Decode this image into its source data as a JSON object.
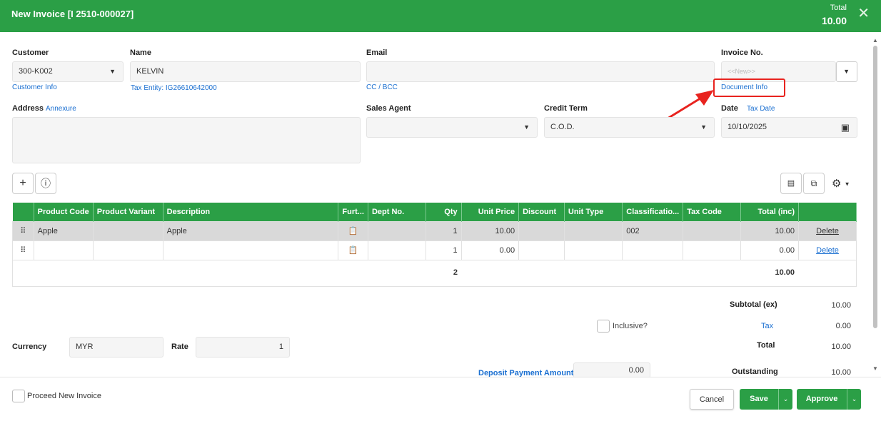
{
  "header": {
    "title": "New Invoice [I 2510-000027]",
    "total_label": "Total",
    "total_value": "10.00",
    "close": "✕"
  },
  "customer": {
    "label": "Customer",
    "value": "300-K002",
    "info_link": "Customer Info"
  },
  "name": {
    "label": "Name",
    "value": "KELVIN",
    "tax_entity": "Tax Entity: IG26610642000"
  },
  "email": {
    "label": "Email",
    "value": "",
    "cc_link": "CC / BCC"
  },
  "invoice_no": {
    "label": "Invoice No.",
    "placeholder": "<<New>>",
    "doc_info_link": "Document Info"
  },
  "address": {
    "label": "Address",
    "annexure_link": "Annexure"
  },
  "sales_agent": {
    "label": "Sales Agent",
    "value": ""
  },
  "credit_term": {
    "label": "Credit Term",
    "value": "C.O.D."
  },
  "date": {
    "label": "Date",
    "tax_date_link": "Tax Date",
    "value": "10/10/2025"
  },
  "toolbar": {
    "add": "+",
    "info": "ⓘ",
    "settings": "⚙"
  },
  "grid": {
    "columns": [
      "",
      "Product Code",
      "Product Variant",
      "Description",
      "Furt...",
      "Dept No.",
      "Qty",
      "Unit Price",
      "Discount",
      "Unit Type",
      "Classificatio...",
      "Tax Code",
      "Total (inc)",
      ""
    ],
    "rows": [
      {
        "product_code": "Apple",
        "variant": "",
        "description": "Apple",
        "dept": "",
        "qty": "1",
        "unit_price": "10.00",
        "discount": "",
        "unit_type": "",
        "classification": "002",
        "tax_code": "",
        "total": "10.00",
        "action": "Delete"
      },
      {
        "product_code": "",
        "variant": "",
        "description": "",
        "dept": "",
        "qty": "1",
        "unit_price": "0.00",
        "discount": "",
        "unit_type": "",
        "classification": "",
        "tax_code": "",
        "total": "0.00",
        "action": "Delete"
      }
    ],
    "total_qty": "2",
    "total_amount": "10.00"
  },
  "summary": {
    "subtotal_label": "Subtotal (ex)",
    "subtotal_value": "10.00",
    "inclusive_label": "Inclusive?",
    "tax_label": "Tax",
    "tax_value": "0.00",
    "total_label": "Total",
    "total_value": "10.00",
    "deposit_label": "Deposit Payment Amount",
    "deposit_value": "0.00",
    "outstanding_label": "Outstanding",
    "outstanding_value": "10.00"
  },
  "currency": {
    "label": "Currency",
    "value": "MYR",
    "rate_label": "Rate",
    "rate_value": "1"
  },
  "footer": {
    "proceed_label": "Proceed New Invoice",
    "cancel": "Cancel",
    "save": "Save",
    "approve": "Approve"
  },
  "colors": {
    "brand_green": "#2b9f46",
    "link_blue": "#1a6fd1",
    "highlight_red": "#e8231f"
  }
}
